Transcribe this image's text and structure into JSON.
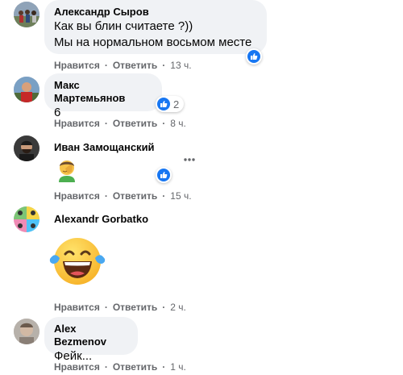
{
  "comments": [
    {
      "author": "Александр Сыров",
      "lines": [
        "Как вы блин считаете ?))",
        "Мы на нормальном восьмом месте"
      ],
      "actions": {
        "like": "Нравится",
        "reply": "Ответить",
        "time": "13 ч."
      },
      "reaction": {
        "icon": "like-icon",
        "count": ""
      }
    },
    {
      "author": "Макс Мартемьянов",
      "lines": [
        "6"
      ],
      "actions": {
        "like": "Нравится",
        "reply": "Ответить",
        "time": "8 ч."
      },
      "reaction": {
        "icon": "like-icon",
        "count": "2"
      }
    },
    {
      "author": "Иван Замощанский",
      "sticker": "facepalm-emoji",
      "actions": {
        "like": "Нравится",
        "reply": "Ответить",
        "time": "15 ч."
      },
      "reaction": {
        "icon": "like-icon",
        "count": ""
      },
      "more_icon": "more-options-icon"
    },
    {
      "author": "Alexandr Gorbatko",
      "sticker": "laughing-tears-emoji",
      "actions": {
        "like": "Нравится",
        "reply": "Ответить",
        "time": "2 ч."
      }
    },
    {
      "author": "Alex Bezmenov",
      "lines": [
        "Фейк..."
      ],
      "actions": {
        "like": "Нравится",
        "reply": "Ответить",
        "time": "1 ч."
      }
    }
  ],
  "separator": "·",
  "colors": {
    "bubble": "#f0f2f5",
    "like_blue": "#1877f2",
    "meta_gray": "#65676b"
  }
}
